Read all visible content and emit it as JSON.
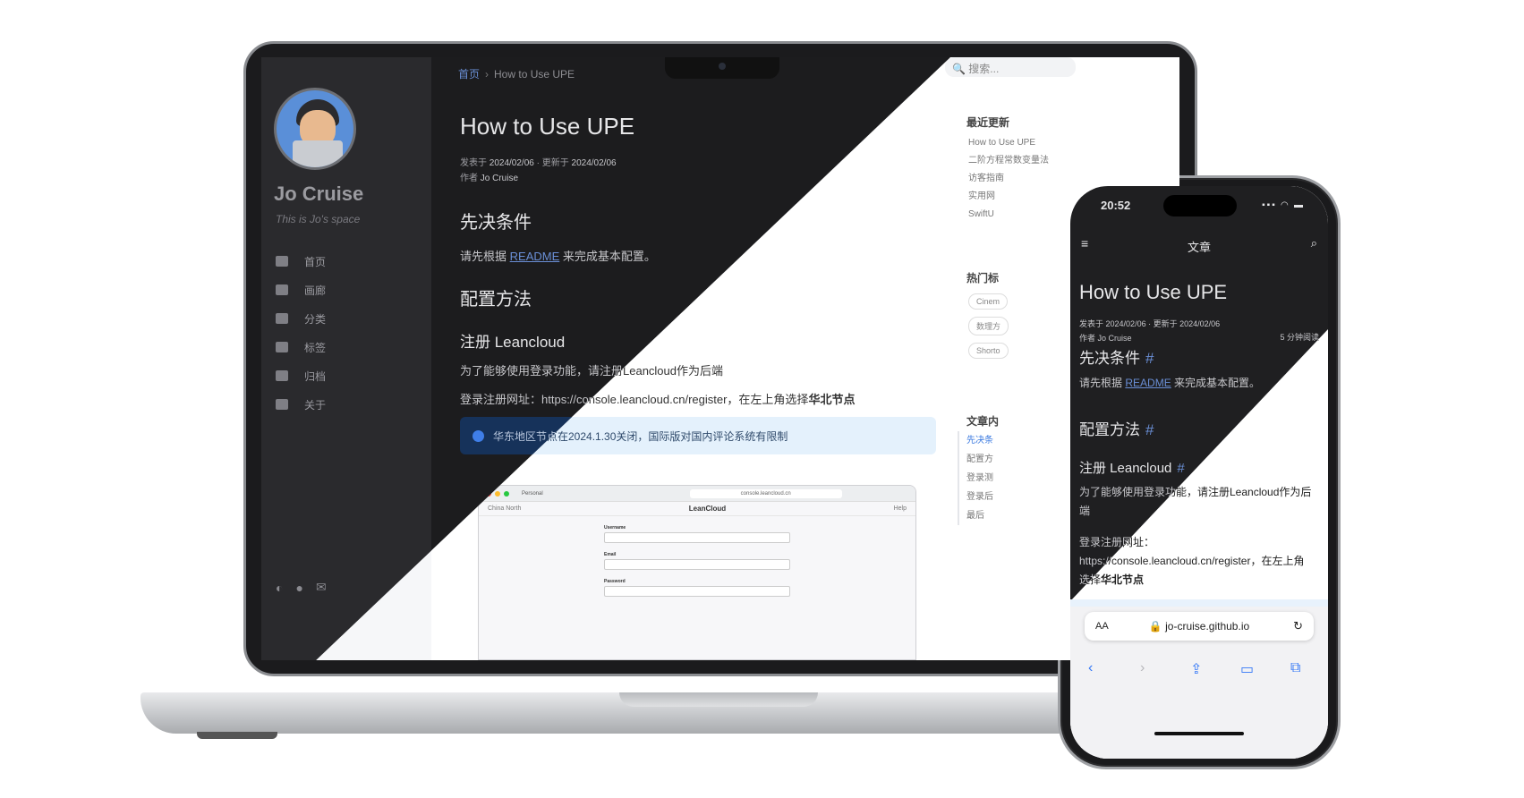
{
  "site": {
    "author_name": "Jo Cruise",
    "tagline": "This is Jo's space"
  },
  "nav": {
    "items": [
      {
        "label": "首页",
        "icon": "home-icon"
      },
      {
        "label": "画廊",
        "icon": "gallery-icon"
      },
      {
        "label": "分类",
        "icon": "list-icon"
      },
      {
        "label": "标签",
        "icon": "tag-icon"
      },
      {
        "label": "归档",
        "icon": "archive-icon"
      },
      {
        "label": "关于",
        "icon": "user-circle-icon"
      }
    ]
  },
  "breadcrumb": {
    "home": "首页",
    "separator": "›",
    "current": "How to Use UPE"
  },
  "search": {
    "placeholder": "搜索..."
  },
  "post": {
    "title": "How to Use UPE",
    "published_label": "发表于",
    "published": "2024/02/06",
    "updated_label": "更新于",
    "updated": "2024/02/06",
    "author_label": "作者",
    "author": "Jo Cruise",
    "read_time": "5 分钟阅读",
    "h_prereq": "先决条件",
    "prereq_text_pre": "请先根据",
    "prereq_link": "README",
    "prereq_text_post": "来完成基本配置。",
    "h_config": "配置方法",
    "h_register": "注册 Leancloud",
    "register_text": "为了能够使用登录功能，请注册Leancloud作为后端",
    "register_url_pre": "登录注册网址：",
    "register_url": "https://console.leancloud.cn/register",
    "register_url_mid": "，在左上角选择",
    "register_url_bold": "华北节点",
    "callout": "华东地区节点在2024.1.30关闭，国际版对国内评论系统有限制",
    "hash": "#"
  },
  "screenshot": {
    "url": "console.leancloud.cn",
    "profile": "Personal",
    "region": "China North",
    "app_title": "LeanCloud",
    "help": "Help",
    "fields": [
      "Username",
      "Email",
      "Password"
    ]
  },
  "right": {
    "recent_heading": "最近更新",
    "recent": [
      "How to Use UPE",
      "二阶方程常数变量法",
      "访客指南",
      "实用网",
      "SwiftU"
    ],
    "hot_heading": "热门标",
    "tags": [
      "Cinem",
      "数理方",
      "Shorto"
    ],
    "toc_heading": "文章内",
    "toc": [
      "先决条",
      "配置方",
      "登录测",
      "登录后",
      "最后"
    ]
  },
  "phone": {
    "time": "20:52",
    "nav_title": "文章",
    "domain": "jo-cruise.github.io",
    "aa": "AA",
    "reg_line1": "https://console.leancloud.cn/register，在左上角",
    "reg_line2_pre": "选择",
    "reg_line2_bold": "华北节点"
  },
  "colors": {
    "accent": "#6a8fd6",
    "dark_bg": "#1c1c1e",
    "callout_bg": "#16325a",
    "safari_blue": "#3478f6"
  }
}
